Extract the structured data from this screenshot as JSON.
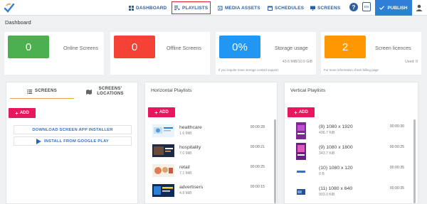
{
  "nav": {
    "dashboard": "DASHBOARD",
    "playlists": "PLAYLISTS",
    "media_assets": "MEDIA ASSETS",
    "schedules": "SCHEDULES",
    "screens": "SCREENS",
    "help": "?",
    "lang": "EN",
    "publish": "PUBLISH"
  },
  "page": {
    "title": "Dashboard"
  },
  "stats": [
    {
      "value": "0",
      "label": "Online Screens",
      "color": "#4caf50"
    },
    {
      "value": "0",
      "label": "Offline Screens",
      "color": "#f44336"
    },
    {
      "value": "0%",
      "label": "Storage usage",
      "sub": "43.6 MiB/10.0 GiB",
      "note": "If you require more storage contact support",
      "color": "#2196f3"
    },
    {
      "value": "2",
      "label": "Screen licences",
      "sub": "Used: 0",
      "note": "For more information check billing page",
      "color": "#ff9800"
    }
  ],
  "screens_panel": {
    "tabs": [
      "SCREENS",
      "SCREENS' LOCATIONS"
    ],
    "add_label": "ADD",
    "download_label": "DOWNLOAD SCREEN APP INSTALLER",
    "google_play_label": "INSTALL FROM GOOGLE PLAY"
  },
  "horizontal": {
    "title": "Horizontal Playlists",
    "add_label": "ADD",
    "items": [
      {
        "name": "healthcare",
        "size": "1.6 MiB",
        "duration": "00:00:28"
      },
      {
        "name": "hospitality",
        "size": "7.0 MiB",
        "duration": "00:00:21"
      },
      {
        "name": "retail",
        "size": "7.1 MiB",
        "duration": "00:00:25"
      },
      {
        "name": "advertisers",
        "size": "4.8 MiB",
        "duration": "00:00:15"
      }
    ]
  },
  "vertical": {
    "title": "Vertical Playlists",
    "add_label": "ADD",
    "items": [
      {
        "name": "(8) 1080 x 1920",
        "size": "436.7 KiB",
        "duration": "00:00:30"
      },
      {
        "name": "(9) 1080 x 1800",
        "size": "343.7 KiB",
        "duration": "00:00:25"
      },
      {
        "name": "(10) 1080 x 120",
        "size": "0 B",
        "duration": "00:00:35"
      },
      {
        "name": "(11) 1080 x 640",
        "size": "903.0 KiB",
        "duration": "00:00:35"
      }
    ]
  }
}
